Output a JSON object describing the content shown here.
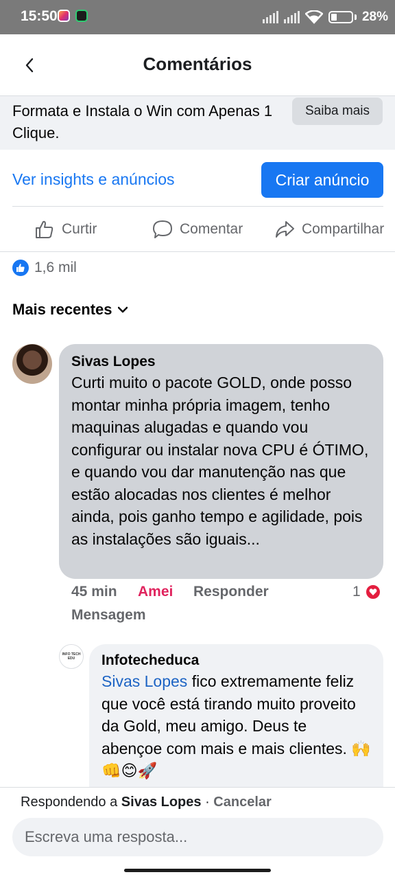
{
  "status_bar": {
    "time": "15:50",
    "battery": "28%"
  },
  "header": {
    "title": "Comentários",
    "back_icon": "chevron-left-icon"
  },
  "ad": {
    "text": "Formata e Instala o Win com Apenas 1 Clique.",
    "learn_more": "Saiba mais",
    "insights_link": "Ver insights e anúncios",
    "create_ad": "Criar anúncio"
  },
  "actions": {
    "like": "Curtir",
    "comment": "Comentar",
    "share": "Compartilhar"
  },
  "reactions": {
    "count": "1,6 mil"
  },
  "sort": {
    "label": "Mais recentes"
  },
  "comment": {
    "author": "Sivas Lopes",
    "text": "Curti muito o pacote GOLD, onde posso montar minha própria imagem, tenho maquinas alugadas e quando vou configurar ou instalar nova CPU é ÓTIMO, e quando vou dar manutenção nas que estão alocadas nos clientes é melhor ainda, pois ganho tempo e agilidade, pois as instalações são iguais...",
    "time": "45 min",
    "reaction": "Amei",
    "reply": "Responder",
    "message": "Mensagem",
    "reaction_count": "1"
  },
  "reply": {
    "author": "Infotecheduca",
    "avatar_text": "INFO TECH EDU",
    "mention": "Sivas Lopes",
    "text": " fico extremamente feliz que você está tirando muito proveito da Gold, meu amigo. Deus te abençoe com mais e mais clientes. 🙌👊😊🚀"
  },
  "reply_bar": {
    "replying_prefix": "Respondendo a ",
    "replying_to": "Sivas Lopes",
    "separator": " · ",
    "cancel": "Cancelar",
    "placeholder": "Escreva uma resposta..."
  },
  "colors": {
    "accent": "#1877f2",
    "love": "#e0245e",
    "bubble": "#d0d3d8"
  }
}
